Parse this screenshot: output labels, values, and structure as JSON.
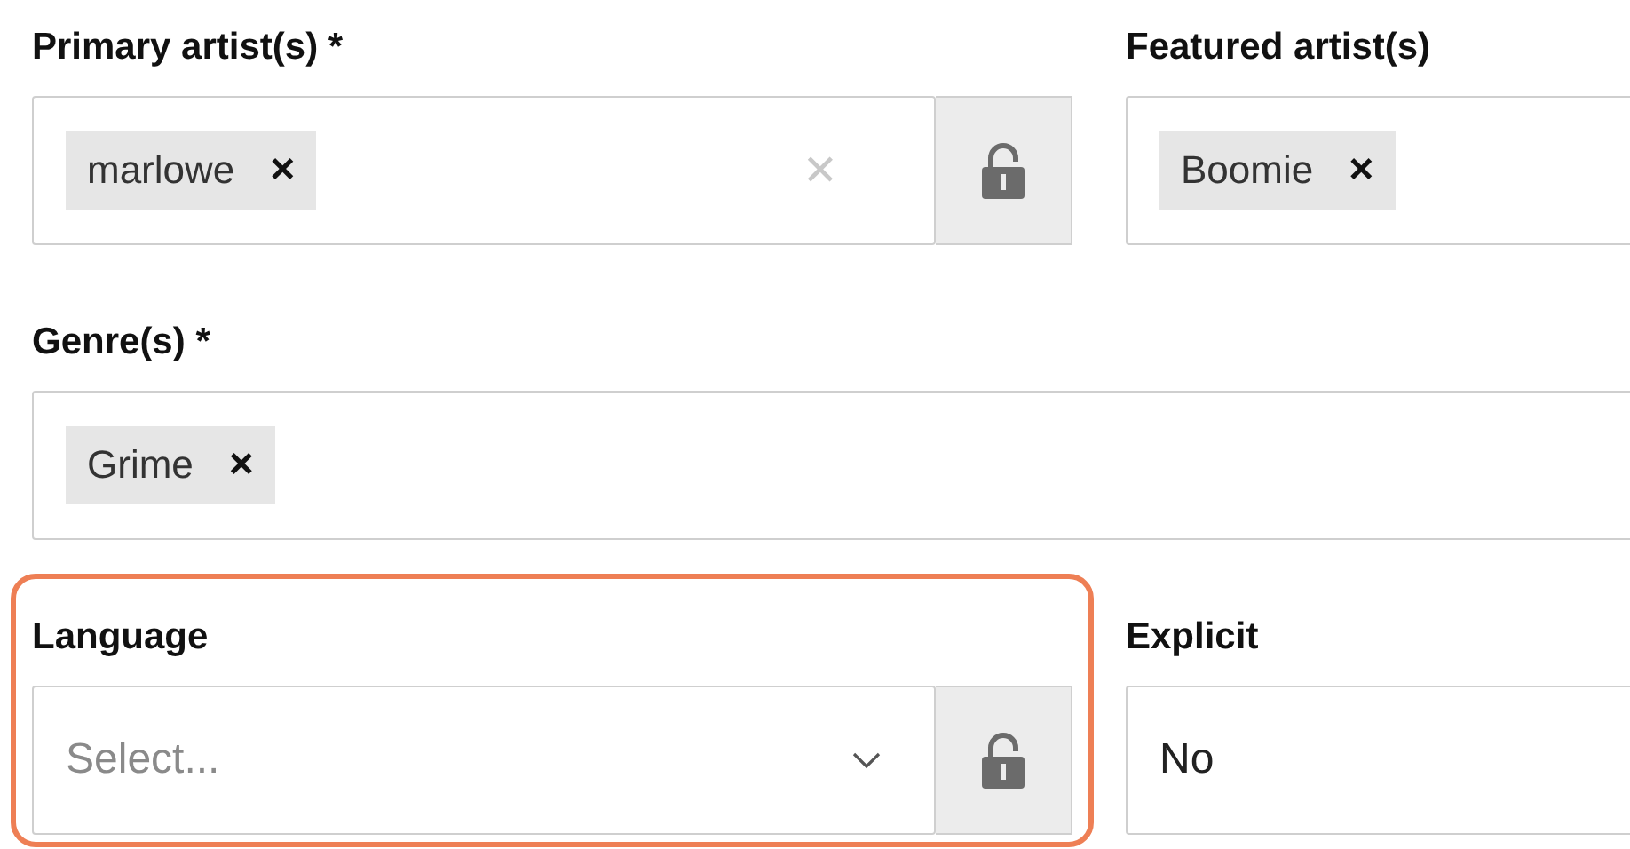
{
  "rows": [
    {
      "fields": [
        {
          "label": "Primary artist(s) *",
          "kind": "tags",
          "highlighted": false,
          "tags": [
            {
              "label": "marlowe",
              "remove": "×"
            }
          ],
          "clear": "✕",
          "lock": {
            "locked": false
          }
        },
        {
          "label": "Featured artist(s)",
          "kind": "tags",
          "highlighted": false,
          "tags": [
            {
              "label": "Boomie",
              "remove": "×"
            }
          ]
        }
      ]
    },
    {
      "fields": [
        {
          "label": "Genre(s) *",
          "kind": "tags",
          "highlighted": false,
          "tags": [
            {
              "label": "Grime",
              "remove": "×"
            }
          ]
        }
      ]
    },
    {
      "fields": [
        {
          "label": "Language",
          "kind": "select",
          "highlighted": true,
          "placeholder": "Select...",
          "lock": {
            "locked": false
          }
        },
        {
          "label": "Explicit",
          "kind": "value",
          "highlighted": false,
          "value": "No"
        }
      ]
    }
  ]
}
